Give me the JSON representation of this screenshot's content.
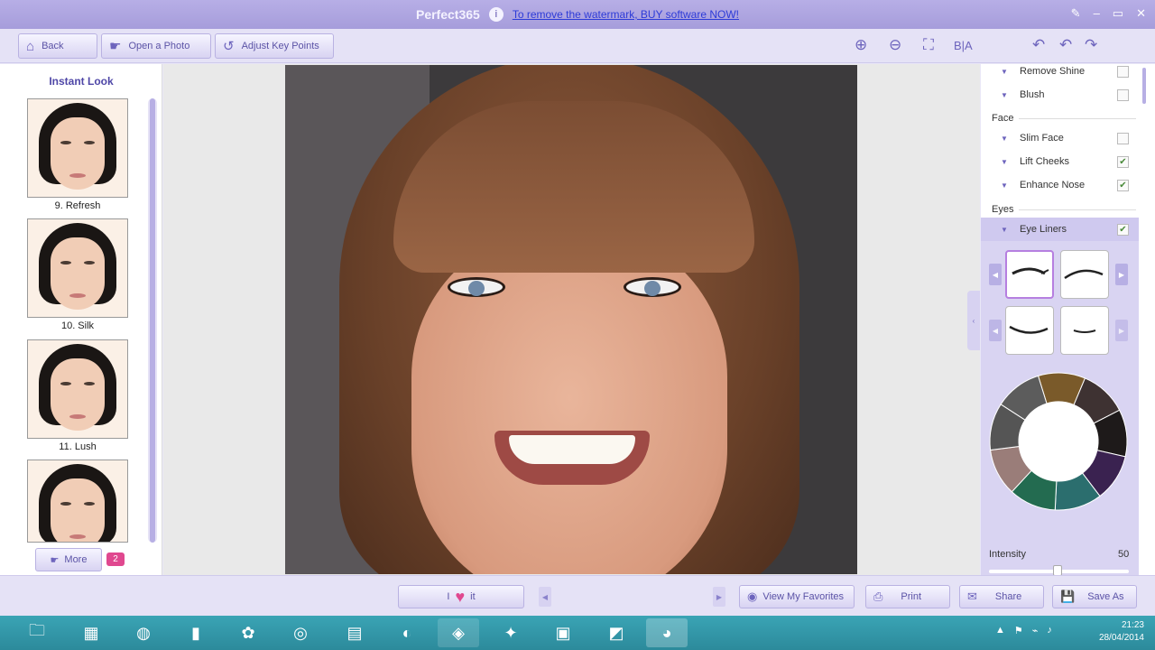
{
  "window": {
    "app_title": "Perfect365",
    "watermark_link": "To remove the watermark, BUY software NOW!",
    "controls": [
      "✎",
      "–",
      "▭",
      "✕"
    ]
  },
  "toolbar": {
    "back_label": "Back",
    "open_photo_label": "Open a Photo",
    "adjust_key_points_label": "Adjust Key Points",
    "ba_label": "B|A"
  },
  "instant_look": {
    "title": "Instant Look",
    "items": [
      {
        "label": "9. Refresh"
      },
      {
        "label": "10. Silk"
      },
      {
        "label": "11. Lush"
      },
      {
        "label": ""
      }
    ],
    "more_label": "More",
    "more_badge": "2"
  },
  "right_panel": {
    "rows_top": [
      {
        "label": "Remove Shine",
        "checked": false
      },
      {
        "label": "Blush",
        "checked": false
      }
    ],
    "face_section": "Face",
    "face_rows": [
      {
        "label": "Slim Face",
        "checked": false
      },
      {
        "label": "Lift Cheeks",
        "checked": true
      },
      {
        "label": "Enhance Nose",
        "checked": true
      }
    ],
    "eyes_section": "Eyes",
    "eye_liners_label": "Eye Liners",
    "eye_liners_checked": true,
    "intensity_label": "Intensity",
    "intensity_value": "50",
    "palette_colors": [
      "#7a5a2a",
      "#3e3232",
      "#1e1a1a",
      "#3a2250",
      "#2b6e6e",
      "#236b50",
      "#9a7d79",
      "#555",
      "#5c5c5c"
    ]
  },
  "bottom": {
    "love_it_left": "I",
    "love_it_right": "it",
    "view_favorites_label": "View My Favorites",
    "print_label": "Print",
    "share_label": "Share",
    "save_as_label": "Save As"
  },
  "taskbar": {
    "time": "21:23",
    "date": "28/04/2014"
  }
}
